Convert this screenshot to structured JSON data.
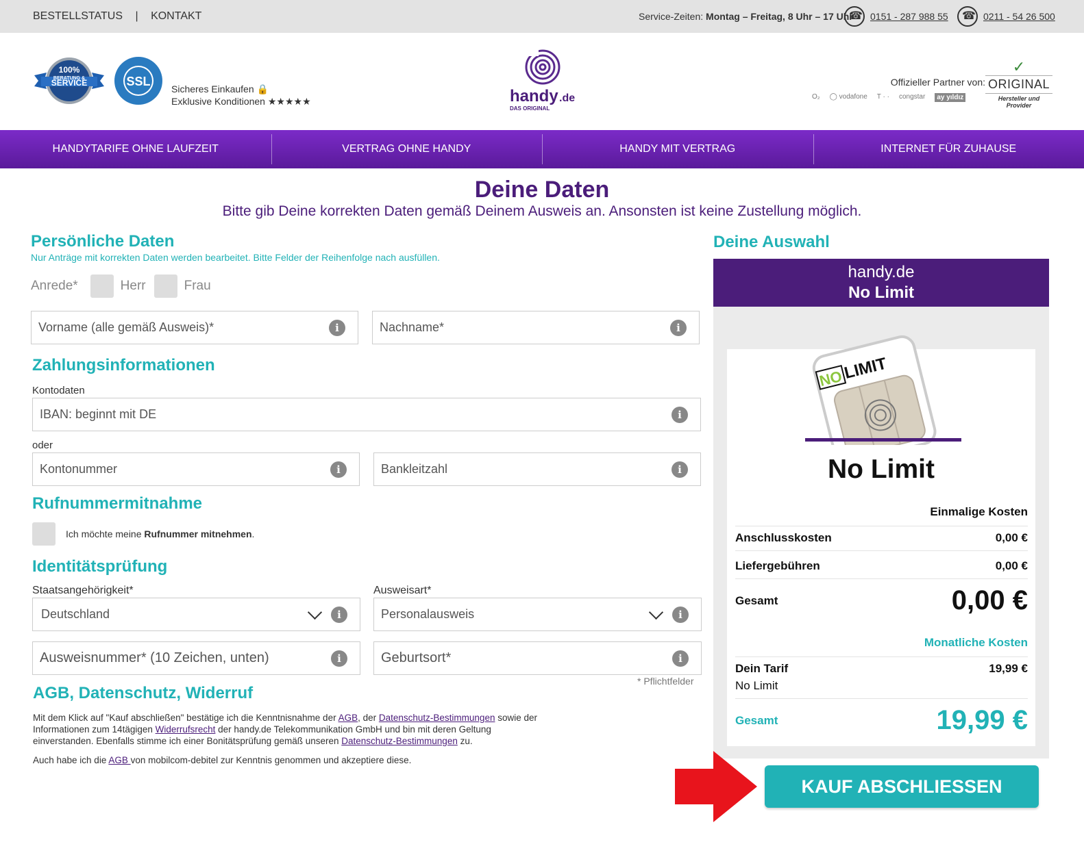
{
  "topbar": {
    "order_status": "BESTELLSTATUS",
    "separator": "|",
    "contact": "KONTAKT",
    "service_label": "Service-Zeiten:",
    "service_hours": "Montag – Freitag, 8 Uhr – 17 Uhr",
    "phone1": "0151 - 287 988 55",
    "phone2": "0211 - 54 26 500"
  },
  "header": {
    "seal1_top": "100%",
    "seal1_mid": "BERATUNG &",
    "seal1_bottom": "SERVICE",
    "seal2": "SSL",
    "trust_line1": "Sicheres Einkaufen 🔒",
    "trust_line2": "Exklusive Konditionen ★★★★★",
    "logo_text": "handy",
    "logo_tld": ".de",
    "logo_sub": "DAS ORIGINAL",
    "partner_label": "Offizieller Partner von:",
    "partners": [
      "O₂",
      "◯ vodafone",
      "T · ·",
      "congstar",
      "ay yıldız"
    ],
    "original": "ORIGINAL",
    "original_sub": "Hersteller und Provider"
  },
  "nav": [
    "HANDYTARIFE OHNE LAUFZEIT",
    "VERTRAG OHNE HANDY",
    "HANDY MIT VERTRAG",
    "INTERNET FÜR ZUHAUSE"
  ],
  "page": {
    "title": "Deine Daten",
    "subtitle": "Bitte gib Deine korrekten Daten gemäß Deinem Ausweis an. Ansonsten ist keine Zustellung möglich."
  },
  "personal": {
    "heading": "Persönliche Daten",
    "note": "Nur Anträge mit korrekten Daten werden bearbeitet. Bitte Felder der Reihenfolge nach ausfüllen.",
    "salutation_label": "Anrede*",
    "option_mr": "Herr",
    "option_mrs": "Frau",
    "firstname_ph": "Vorname (alle gemäß Ausweis)*",
    "lastname_ph": "Nachname*"
  },
  "payment": {
    "heading": "Zahlungsinformationen",
    "account_label": "Kontodaten",
    "iban_ph": "IBAN: beginnt mit DE",
    "or": "oder",
    "account_number_ph": "Kontonummer",
    "bank_code_ph": "Bankleitzahl"
  },
  "porting": {
    "heading": "Rufnummermitnahme",
    "label_pre": "Ich möchte meine ",
    "label_bold": "Rufnummer mitnehmen",
    "label_post": "."
  },
  "identity": {
    "heading": "Identitätsprüfung",
    "nationality_label": "Staatsangehörigkeit*",
    "nationality_value": "Deutschland",
    "id_type_label": "Ausweisart*",
    "id_type_value": "Personalausweis",
    "id_number_ph": "Ausweisnummer* (10 Zeichen, unten)",
    "birthplace_ph": "Geburtsort*",
    "required_note": "* Pflichtfelder"
  },
  "legal": {
    "heading": "AGB, Datenschutz, Widerruf",
    "t1": "Mit dem Klick auf \"Kauf abschließen\" bestätige ich die Kenntnisnahme der ",
    "l1": "AGB",
    "t2": ", der ",
    "l2": "Datenschutz-Bestimmungen",
    "t3": " sowie der Informationen zum 14tägigen ",
    "l3": "Widerrufsrecht",
    "t4": " der handy.de Telekommunikation GmbH und bin mit deren Geltung einverstanden. Ebenfalls stimme ich einer Bonitätsprüfung gemäß unseren ",
    "l4": "Datenschutz-Bestimmungen",
    "t5": " zu.",
    "p2_pre": "Auch habe ich die ",
    "p2_link": "AGB ",
    "p2_post": "von mobilcom-debitel zur Kenntnis genommen und akzeptiere diese."
  },
  "summary": {
    "heading": "Deine Auswahl",
    "brand": "handy.de",
    "plan": "No Limit",
    "sim_no": "NO",
    "sim_limit": "LIMIT",
    "product": "No Limit",
    "one_time_label": "Einmalige Kosten",
    "connection_label": "Anschlusskosten",
    "connection_value": "0,00 €",
    "delivery_label": "Liefergebühren",
    "delivery_value": "0,00 €",
    "total_label": "Gesamt",
    "total_value": "0,00 €",
    "monthly_label": "Monatliche Kosten",
    "tariff_label": "Dein Tarif",
    "tariff_value": "19,99 €",
    "tariff_name": "No Limit",
    "monthly_total_label": "Gesamt",
    "monthly_total_value": "19,99 €"
  },
  "cta": {
    "label": "KAUF ABSCHLIESSEN"
  },
  "colors": {
    "purple": "#4b1d7a",
    "nav_purple": "#7b2bc8",
    "teal": "#21b2b6",
    "arrow_red": "#e8141c"
  }
}
